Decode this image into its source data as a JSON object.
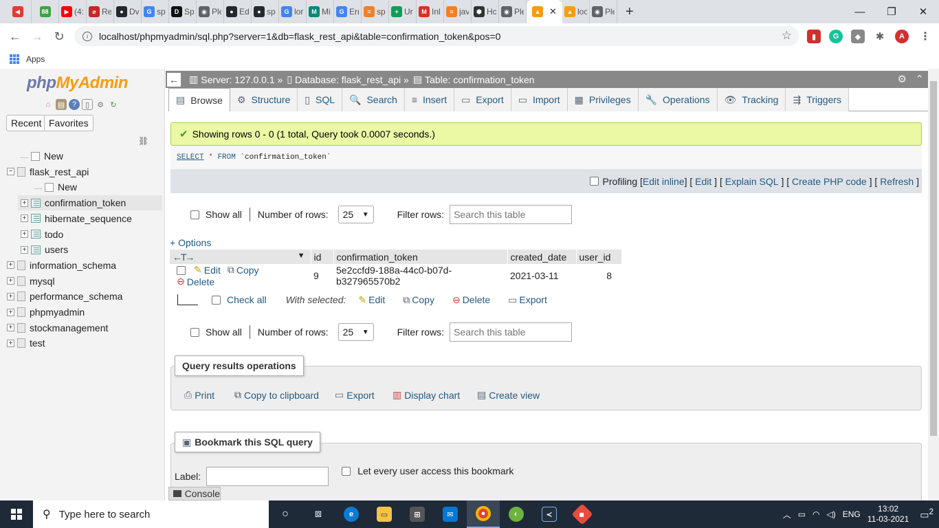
{
  "browser": {
    "tabs": [
      {
        "icon": "back-red-icon",
        "label": "",
        "color": "#e53935"
      },
      {
        "icon": "app-88-icon",
        "label": "",
        "color": "#43a047",
        "glyph": "88"
      },
      {
        "icon": "youtube-icon",
        "label": "(4:",
        "color": "#ff0000",
        "glyph": "▶"
      },
      {
        "icon": "tab-re-icon",
        "label": "Re",
        "color": "#c62828",
        "glyph": "⌀"
      },
      {
        "icon": "github-icon",
        "label": "Dv",
        "color": "#24292e",
        "glyph": "●"
      },
      {
        "icon": "google-icon",
        "label": "sp",
        "color": "#4285f4",
        "glyph": "G"
      },
      {
        "icon": "app-dev-icon",
        "label": "Sp",
        "color": "#111111",
        "glyph": "D"
      },
      {
        "icon": "globe-icon",
        "label": "Ple",
        "color": "#5f6368",
        "glyph": "◉"
      },
      {
        "icon": "github-icon",
        "label": "Ed",
        "color": "#24292e",
        "glyph": "●"
      },
      {
        "icon": "github-icon",
        "label": "sp",
        "color": "#24292e",
        "glyph": "●"
      },
      {
        "icon": "google-icon",
        "label": "lor",
        "color": "#4285f4",
        "glyph": "G"
      },
      {
        "icon": "meet-icon",
        "label": "Mi",
        "color": "#00897b",
        "glyph": "M"
      },
      {
        "icon": "google-icon",
        "label": "Err",
        "color": "#4285f4",
        "glyph": "G"
      },
      {
        "icon": "stackoverflow-icon",
        "label": "sp",
        "color": "#f48024",
        "glyph": "≡"
      },
      {
        "icon": "sheets-icon",
        "label": "Ur",
        "color": "#0f9d58",
        "glyph": "+"
      },
      {
        "icon": "gmail-icon",
        "label": "Inl",
        "color": "#d93025",
        "glyph": "M"
      },
      {
        "icon": "stackoverflow-icon",
        "label": "jav",
        "color": "#f48024",
        "glyph": "≡"
      },
      {
        "icon": "hex-icon",
        "label": "Hc",
        "color": "#333333",
        "glyph": "⬢"
      },
      {
        "icon": "globe-icon",
        "label": "Ple",
        "color": "#5f6368",
        "glyph": "◉"
      },
      {
        "icon": "pma-icon",
        "label": "",
        "color": "#f89c0e",
        "glyph": "▲",
        "active": true
      },
      {
        "icon": "pma-icon",
        "label": "loc",
        "color": "#f89c0e",
        "glyph": "▲"
      },
      {
        "icon": "globe-icon",
        "label": "Ple",
        "color": "#5f6368",
        "glyph": "◉"
      }
    ],
    "url": "localhost/phpmyadmin/sql.php?server=1&db=flask_rest_api&table=confirmation_token&pos=0",
    "bookmarks_apps": "Apps"
  },
  "sidebar": {
    "logo_php": "php",
    "logo_myadmin": "MyAdmin",
    "recent": "Recent",
    "favorites": "Favorites",
    "tree": [
      {
        "label": "New",
        "level": 1,
        "kind": "new",
        "expander": ""
      },
      {
        "label": "flask_rest_api",
        "level": 0,
        "kind": "db",
        "expander": "−"
      },
      {
        "label": "New",
        "level": 2,
        "kind": "new",
        "expander": ""
      },
      {
        "label": "confirmation_token",
        "level": 1,
        "kind": "table",
        "expander": "+",
        "selected": true
      },
      {
        "label": "hibernate_sequence",
        "level": 1,
        "kind": "table",
        "expander": "+"
      },
      {
        "label": "todo",
        "level": 1,
        "kind": "table",
        "expander": "+"
      },
      {
        "label": "users",
        "level": 1,
        "kind": "table",
        "expander": "+"
      },
      {
        "label": "information_schema",
        "level": 0,
        "kind": "db",
        "expander": "+"
      },
      {
        "label": "mysql",
        "level": 0,
        "kind": "db",
        "expander": "+"
      },
      {
        "label": "performance_schema",
        "level": 0,
        "kind": "db",
        "expander": "+"
      },
      {
        "label": "phpmyadmin",
        "level": 0,
        "kind": "db",
        "expander": "+"
      },
      {
        "label": "stockmanagement",
        "level": 0,
        "kind": "db",
        "expander": "+"
      },
      {
        "label": "test",
        "level": 0,
        "kind": "db",
        "expander": "+"
      }
    ]
  },
  "breadcrumb": {
    "server": "Server: 127.0.0.1 »",
    "database": "Database: flask_rest_api »",
    "table": "Table: confirmation_token"
  },
  "menu": [
    {
      "label": "Browse",
      "icon": "browse-icon",
      "glyph": "▤",
      "active": true
    },
    {
      "label": "Structure",
      "icon": "structure-icon",
      "glyph": "⚙"
    },
    {
      "label": "SQL",
      "icon": "sql-icon",
      "glyph": "▯"
    },
    {
      "label": "Search",
      "icon": "search-icon",
      "glyph": "🔍"
    },
    {
      "label": "Insert",
      "icon": "insert-icon",
      "glyph": "≡"
    },
    {
      "label": "Export",
      "icon": "export-icon",
      "glyph": "▭"
    },
    {
      "label": "Import",
      "icon": "import-icon",
      "glyph": "▭"
    },
    {
      "label": "Privileges",
      "icon": "privileges-icon",
      "glyph": "▦"
    },
    {
      "label": "Operations",
      "icon": "wrench-icon",
      "glyph": "🔧"
    },
    {
      "label": "Tracking",
      "icon": "eye-icon",
      "glyph": "👁"
    },
    {
      "label": "Triggers",
      "icon": "triggers-icon",
      "glyph": "⇶"
    }
  ],
  "success_message": "Showing rows 0 - 0 (1 total, Query took 0.0007 seconds.)",
  "sql": {
    "select": "SELECT",
    "star": "*",
    "from": "FROM",
    "table": "`confirmation_token`"
  },
  "tools": {
    "profiling": "Profiling",
    "edit_inline": "Edit inline",
    "edit": "Edit",
    "explain": "Explain SQL",
    "create_php": "Create PHP code",
    "refresh": "Refresh"
  },
  "navigation": {
    "show_all": "Show all",
    "rows_label": "Number of rows:",
    "rows_value": "25",
    "filter_label": "Filter rows:",
    "filter_placeholder": "Search this table"
  },
  "options_link": "+ Options",
  "table": {
    "columns": [
      "id",
      "confirmation_token",
      "created_date",
      "user_id"
    ],
    "rows": [
      {
        "id": "9",
        "confirmation_token": "5e2ccfd9-188a-44c0-b07d-b327965570b2",
        "created_date": "2021-03-11",
        "user_id": "8"
      }
    ],
    "row_actions": {
      "edit": "Edit",
      "copy": "Copy",
      "delete": "Delete"
    }
  },
  "bulk": {
    "check_all": "Check all",
    "with_selected": "With selected:",
    "edit": "Edit",
    "copy": "Copy",
    "delete": "Delete",
    "export": "Export"
  },
  "query_ops": {
    "title": "Query results operations",
    "print": "Print",
    "copy": "Copy to clipboard",
    "export": "Export",
    "chart": "Display chart",
    "view": "Create view"
  },
  "bookmark": {
    "title": "Bookmark this SQL query",
    "label": "Label:",
    "every_user": "Let every user access this bookmark"
  },
  "console": "Console",
  "taskbar": {
    "search_placeholder": "Type here to search",
    "lang": "ENG",
    "time": "13:02",
    "date": "11-03-2021",
    "notifications": "2"
  }
}
